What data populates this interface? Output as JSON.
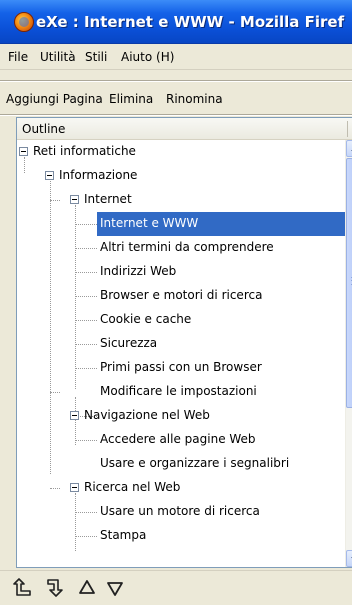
{
  "window": {
    "title": "eXe : Internet e WWW - Mozilla Firef",
    "icon": "firefox-icon"
  },
  "menubar": {
    "items": [
      "File",
      "Utilità",
      "Stili",
      "Aiuto (H)"
    ]
  },
  "toolbar": {
    "add_page": "Aggiungi Pagina",
    "delete": "Elimina",
    "rename": "Rinomina"
  },
  "outline": {
    "header": "Outline",
    "nodes": [
      {
        "label": "Reti informatiche"
      },
      {
        "label": "Informazione"
      },
      {
        "label": "Internet"
      },
      {
        "label": "Internet e WWW"
      },
      {
        "label": "Altri termini da comprendere"
      },
      {
        "label": "Indirizzi Web"
      },
      {
        "label": "Browser e motori di ricerca"
      },
      {
        "label": "Cookie e cache"
      },
      {
        "label": "Sicurezza"
      },
      {
        "label": "Primi passi con un Browser"
      },
      {
        "label": "Modificare le impostazioni"
      },
      {
        "label": "Navigazione nel Web"
      },
      {
        "label": "Accedere alle pagine Web"
      },
      {
        "label": "Usare e organizzare i segnalibri"
      },
      {
        "label": "Ricerca nel Web"
      },
      {
        "label": "Usare un motore di ricerca"
      },
      {
        "label": "Stampa"
      }
    ],
    "selected_index": 3
  },
  "bottom_toolbar": {
    "buttons": [
      "promote-icon",
      "demote-icon",
      "move-up-icon",
      "move-down-icon"
    ]
  },
  "colors": {
    "titlebar": "#0a4fd6",
    "selection": "#316ac5",
    "window_bg": "#ece9d8"
  }
}
